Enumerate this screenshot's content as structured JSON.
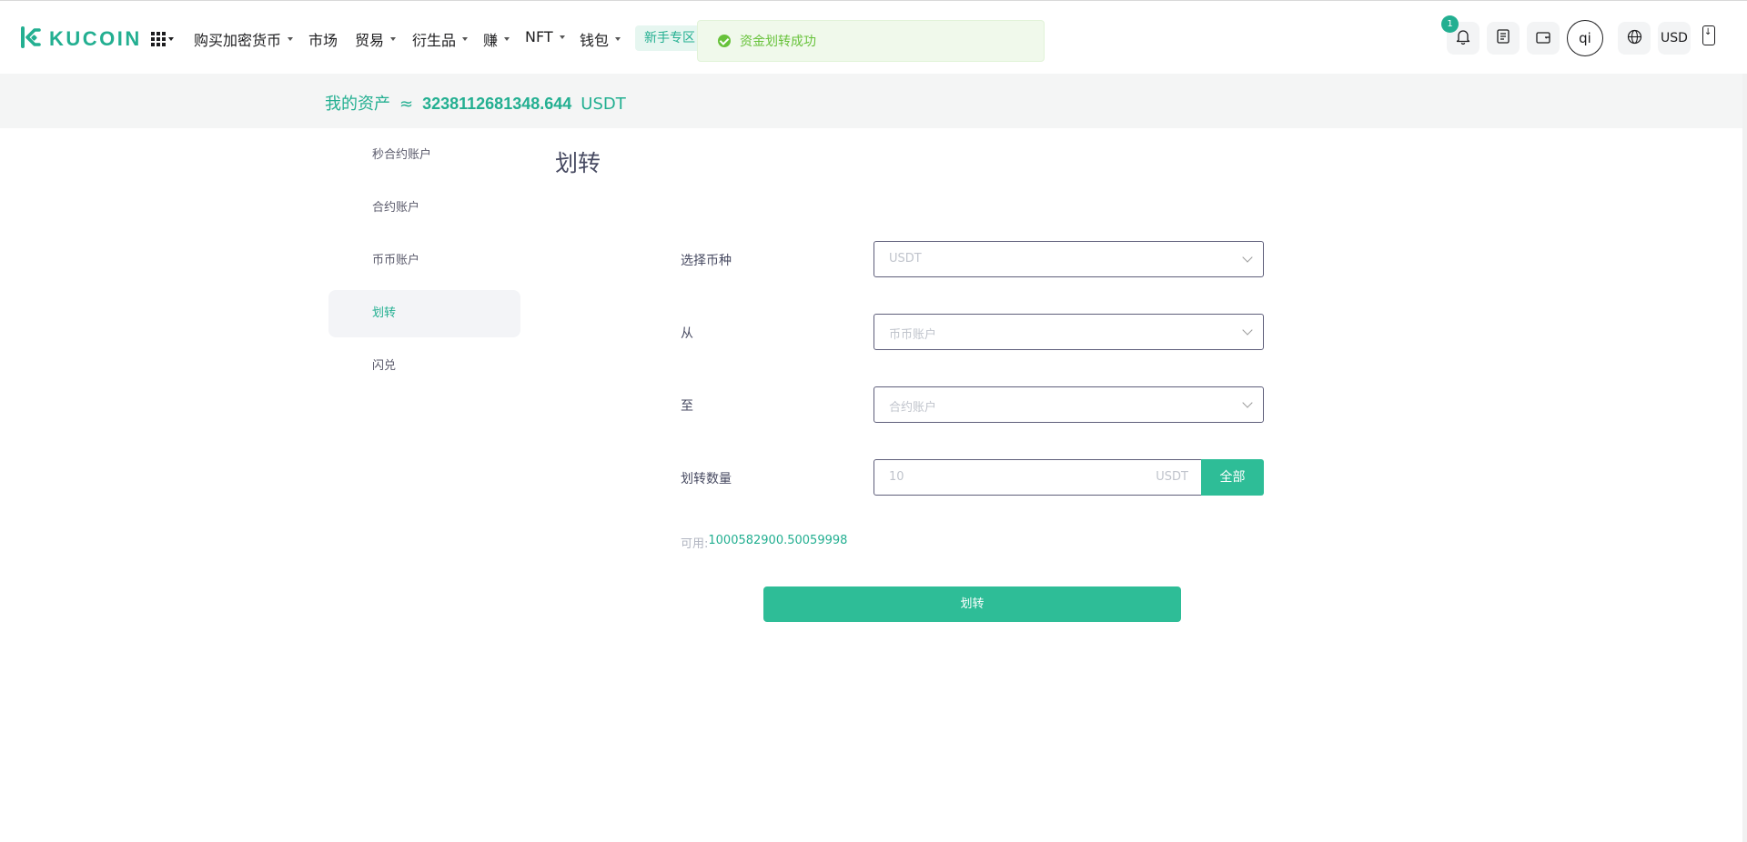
{
  "header": {
    "logo_text": "KUCOIN",
    "nav": [
      {
        "label": "购买加密货币"
      },
      {
        "label": "市场"
      },
      {
        "label": "贸易"
      },
      {
        "label": "衍生品"
      },
      {
        "label": "赚"
      },
      {
        "label": "NFT"
      },
      {
        "label": "钱包"
      }
    ],
    "promo": "新手专区",
    "notification_count": "1",
    "avatar_initials": "qi",
    "currency": "USD"
  },
  "toast": {
    "message": "资金划转成功",
    "status": "success"
  },
  "assets": {
    "label": "我的资产",
    "approx": "≈",
    "value": "3238112681348.644",
    "unit": "USDT"
  },
  "sidebar": {
    "items": [
      {
        "label": "秒合约账户"
      },
      {
        "label": "合约账户"
      },
      {
        "label": "币币账户"
      },
      {
        "label": "划转"
      },
      {
        "label": "闪兑"
      }
    ],
    "active": "划转"
  },
  "form": {
    "title": "划转",
    "coin_label": "选择币种",
    "coin_value": "USDT",
    "from_label": "从",
    "from_value": "币币账户",
    "to_label": "至",
    "to_value": "合约账户",
    "amount_label": "划转数量",
    "amount_placeholder": "10",
    "amount_unit": "USDT",
    "all_button": "全部",
    "available_label": "可用:",
    "available_value": "1000582900.50059998",
    "submit_button": "划转"
  },
  "colors": {
    "brand": "#23af91",
    "button": "#2ebd97",
    "toast_text": "#67c23a"
  }
}
